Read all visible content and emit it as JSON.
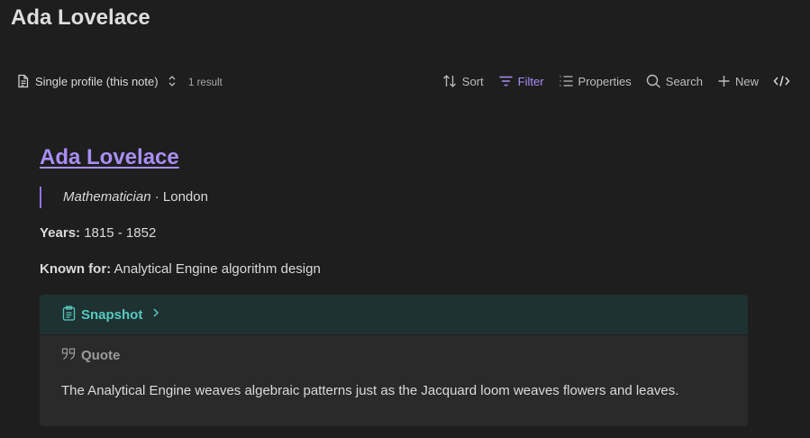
{
  "page": {
    "title": "Ada Lovelace"
  },
  "toolbar": {
    "view_label": "Single profile (this note)",
    "result_count": "1 result",
    "sort_label": "Sort",
    "filter_label": "Filter",
    "properties_label": "Properties",
    "search_label": "Search",
    "new_label": "New",
    "icons": [
      "document-icon",
      "chevrons-updown-icon",
      "sort-icon",
      "filter-icon",
      "list-icon",
      "search-icon",
      "plus-icon",
      "code-icon"
    ]
  },
  "card": {
    "title": "Ada Lovelace",
    "role": "Mathematician",
    "separator": " · ",
    "location": "London",
    "years_label": "Years:",
    "years_value": "1815 - 1852",
    "known_label": "Known for:",
    "known_value": "Analytical Engine algorithm design",
    "callout_title": "Snapshot",
    "quote_heading": "Quote",
    "quote_text": "The Analytical Engine weaves algebraic patterns just as the Jacquard loom weaves flowers and leaves."
  },
  "colors": {
    "accent": "#a98ef5",
    "callout_teal": "#56c8c0",
    "background": "#1e1e1e"
  }
}
